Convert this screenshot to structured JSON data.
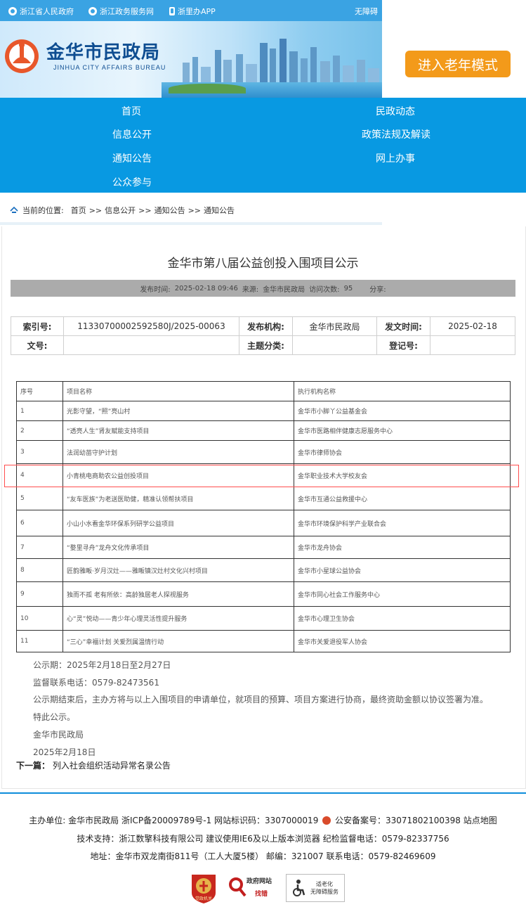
{
  "topbar": {
    "links": [
      "浙江省人民政府",
      "浙江政务服务网",
      "浙里办APP"
    ],
    "accessibility": "无障碍"
  },
  "header": {
    "title_cn": "金华市民政局",
    "title_en": "JINHUA CITY AFFAIRS BUREAU",
    "elder_mode": "进入老年模式"
  },
  "nav": {
    "items": [
      "首页",
      "民政动态",
      "信息公开",
      "政策法规及解读",
      "通知公告",
      "网上办事",
      "公众参与"
    ]
  },
  "breadcrumb": {
    "prefix": "当前的位置:",
    "items": [
      "首页",
      "信息公开",
      "通知公告",
      "通知公告"
    ],
    "sep": ">>"
  },
  "article": {
    "title": "金华市第八届公益创投入围项目公示",
    "meta": {
      "publish_label": "发布时间:",
      "publish_time": "2025-02-18 09:46",
      "source_label": "来源:",
      "source": "金华市民政局",
      "visits_label": "访问次数:",
      "visits": "95",
      "share_label": "分享:"
    },
    "info": {
      "index_label": "索引号:",
      "index": "11330700002592580J/2025-00063",
      "org_label": "发布机构:",
      "org": "金华市民政局",
      "date_label": "发文时间:",
      "date": "2025-02-18",
      "docno_label": "文号:",
      "docno": "",
      "topic_label": "主题分类:",
      "topic": "",
      "reg_label": "登记号:",
      "reg": ""
    },
    "table": {
      "headers": [
        "序号",
        "项目名称",
        "执行机构名称"
      ],
      "rows": [
        [
          "1",
          "光影守望，“照”亮山村",
          "金华市小脚丫公益基金会"
        ],
        [
          "2",
          "“透亮人生”肾友赋能支持项目",
          "金华市医路相伴健康志愿服务中心"
        ],
        [
          "3",
          "法润幼苗守护计划",
          "金华市律师协会"
        ],
        [
          "4",
          "小青桃电商助农公益创投项目",
          "金华职业技术大学校友会"
        ],
        [
          "5",
          "“友车医族”为老送医助健，精准认领帮扶项目",
          "金华市互通公益救援中心"
        ],
        [
          "6",
          "小山小水看金华环保系列研学公益项目",
          "金华市环境保护科学产业联合会"
        ],
        [
          "7",
          "“婺里寻舟”龙舟文化传承项目",
          "金华市龙舟协会"
        ],
        [
          "8",
          "匠韵雅畈·岁月汉灶——雅畈镇汉灶村文化兴村项目",
          "金华市小星球公益协会"
        ],
        [
          "9",
          "独而不孤 老有所依：高龄独居老人探视服务",
          "金华市同心社会工作服务中心"
        ],
        [
          "10",
          "心“灵”悦动——青少年心理灵活性提升服务",
          "金华市心理卫生协会"
        ],
        [
          "11",
          "“三心”幸福计划 关爱烈属温情行动",
          "金华市关爱退役军人协会"
        ]
      ]
    },
    "notes": [
      "公示期：2025年2月18日至2月27日",
      "监督联系电话：0579-82473561",
      "公示期结束后，主办方将与以上入围项目的申请单位，就项目的预算、项目方案进行协商，最终资助金额以协议签署为准。",
      "特此公示。",
      "金华市民政局",
      "2025年2月18日"
    ],
    "next_label": "下一篇：",
    "next_title": "列入社会组织活动异常名录公告"
  },
  "footer": {
    "line1_a": "主办单位: 金华市民政局 浙ICP备20009789号-1 网站标识码：3307000019",
    "line1_b": "公安备案号：33071802100398 站点地图",
    "line2": "技术支持：浙江数擎科技有限公司 建议使用IE6及以上版本浏览器 纪检监督电话：0579-82337756",
    "line3": "地址：金华市双龙南街811号（工人大厦5楼） 邮编：321007 联系电话：0579-82469609",
    "badge_party": "党政机关",
    "badge_error_1": "政府网站",
    "badge_error_2": "找错",
    "badge_access_1": "适老化",
    "badge_access_2": "无障碍服务"
  },
  "colors": {
    "topbar": "#3aa3e3",
    "nav": "#0899e2",
    "elder_button": "#f39a1a",
    "highlight_border": "#ff4d4d"
  }
}
